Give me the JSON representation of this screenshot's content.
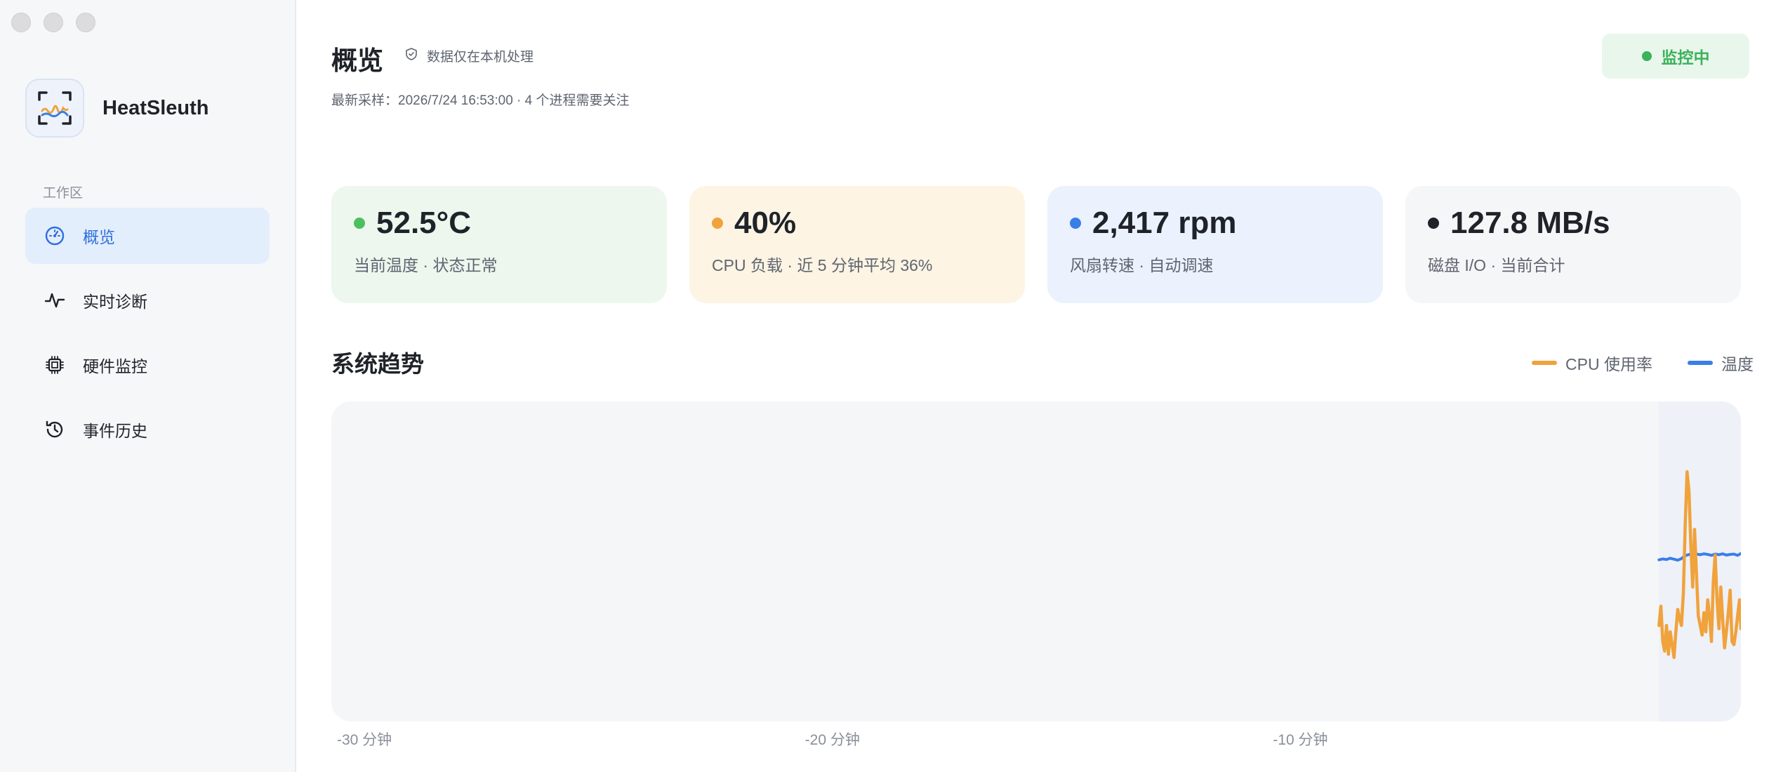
{
  "app": {
    "name": "HeatSleuth"
  },
  "sidebar": {
    "section_label": "工作区",
    "items": [
      {
        "label": "概览",
        "icon": "gauge-icon",
        "active": true
      },
      {
        "label": "实时诊断",
        "icon": "pulse-icon",
        "active": false
      },
      {
        "label": "硬件监控",
        "icon": "chip-icon",
        "active": false
      },
      {
        "label": "事件历史",
        "icon": "history-icon",
        "active": false
      }
    ]
  },
  "header": {
    "title": "概览",
    "privacy_note": "数据仅在本机处理",
    "subtitle": "最新采样：2026/7/24 16:53:00 · 4 个进程需要关注",
    "status": "监控中"
  },
  "colors": {
    "accent": "#2f6fde",
    "ok": "#3cb25a",
    "cpu": "#f0a23b",
    "temp": "#3a7ee8"
  },
  "cards": [
    {
      "value": "52.5°C",
      "caption": "当前温度 · 状态正常",
      "bg": "#edf7ee",
      "dot": "#4cbf5f"
    },
    {
      "value": "40%",
      "caption": "CPU 负载 · 近 5 分钟平均 36%",
      "bg": "#fdf4e3",
      "dot": "#f0a23b"
    },
    {
      "value": "2,417 rpm",
      "caption": "风扇转速 · 自动调速",
      "bg": "#ebf2fd",
      "dot": "#3a7ee8"
    },
    {
      "value": "127.8 MB/s",
      "caption": "磁盘 I/O · 当前合计",
      "bg": "#f5f6f8",
      "dot": "#1f2329"
    }
  ],
  "trend": {
    "title": "系统趋势",
    "legend": [
      {
        "name": "CPU 使用率",
        "color": "#f0a23b"
      },
      {
        "name": "温度",
        "color": "#3a7ee8"
      }
    ]
  },
  "chart_data": {
    "type": "line",
    "x_range": [
      -30,
      0
    ],
    "x_ticks": [
      {
        "x": -30,
        "label": "-30 分钟"
      },
      {
        "x": -20,
        "label": "-20 分钟"
      },
      {
        "x": -10,
        "label": "-10 分钟"
      }
    ],
    "y_range": [
      0,
      100
    ],
    "grid": false,
    "legend_position": "top-right",
    "series": [
      {
        "name": "CPU 使用率",
        "color": "#f0a23b",
        "x": [
          -1.75,
          -1.71,
          -1.67,
          -1.63,
          -1.59,
          -1.55,
          -1.51,
          -1.47,
          -1.43,
          -1.39,
          -1.35,
          -1.31,
          -1.27,
          -1.23,
          -1.19,
          -1.15,
          -1.11,
          -1.07,
          -1.03,
          -0.99,
          -0.95,
          -0.91,
          -0.87,
          -0.83,
          -0.79,
          -0.75,
          -0.71,
          -0.67,
          -0.63,
          -0.59,
          -0.55,
          -0.51,
          -0.47,
          -0.43,
          -0.39,
          -0.35,
          -0.31,
          -0.27,
          -0.23,
          -0.19,
          -0.15,
          -0.11,
          -0.07,
          -0.03,
          0
        ],
        "values": [
          30,
          36,
          25,
          22,
          30,
          21,
          28,
          24,
          20,
          28,
          35,
          32,
          30,
          40,
          62,
          78,
          72,
          55,
          42,
          60,
          46,
          33,
          30,
          27,
          34,
          28,
          38,
          33,
          25,
          44,
          52,
          38,
          29,
          42,
          32,
          23,
          28,
          34,
          41,
          25,
          24,
          28,
          33,
          38,
          29
        ]
      },
      {
        "name": "温度",
        "color": "#3a7ee8",
        "x": [
          -1.75,
          -1.67,
          -1.59,
          -1.51,
          -1.43,
          -1.35,
          -1.27,
          -1.19,
          -1.11,
          -1.03,
          -0.95,
          -0.87,
          -0.79,
          -0.71,
          -0.63,
          -0.55,
          -0.47,
          -0.39,
          -0.31,
          -0.23,
          -0.15,
          -0.07,
          0
        ],
        "values": [
          50.5,
          50.8,
          50.6,
          51.0,
          50.7,
          50.4,
          50.9,
          51.8,
          52.2,
          52.0,
          52.3,
          52.1,
          52.4,
          52.2,
          51.9,
          52.3,
          52.1,
          52.4,
          52.0,
          52.2,
          52.3,
          51.9,
          52.5
        ]
      }
    ]
  }
}
